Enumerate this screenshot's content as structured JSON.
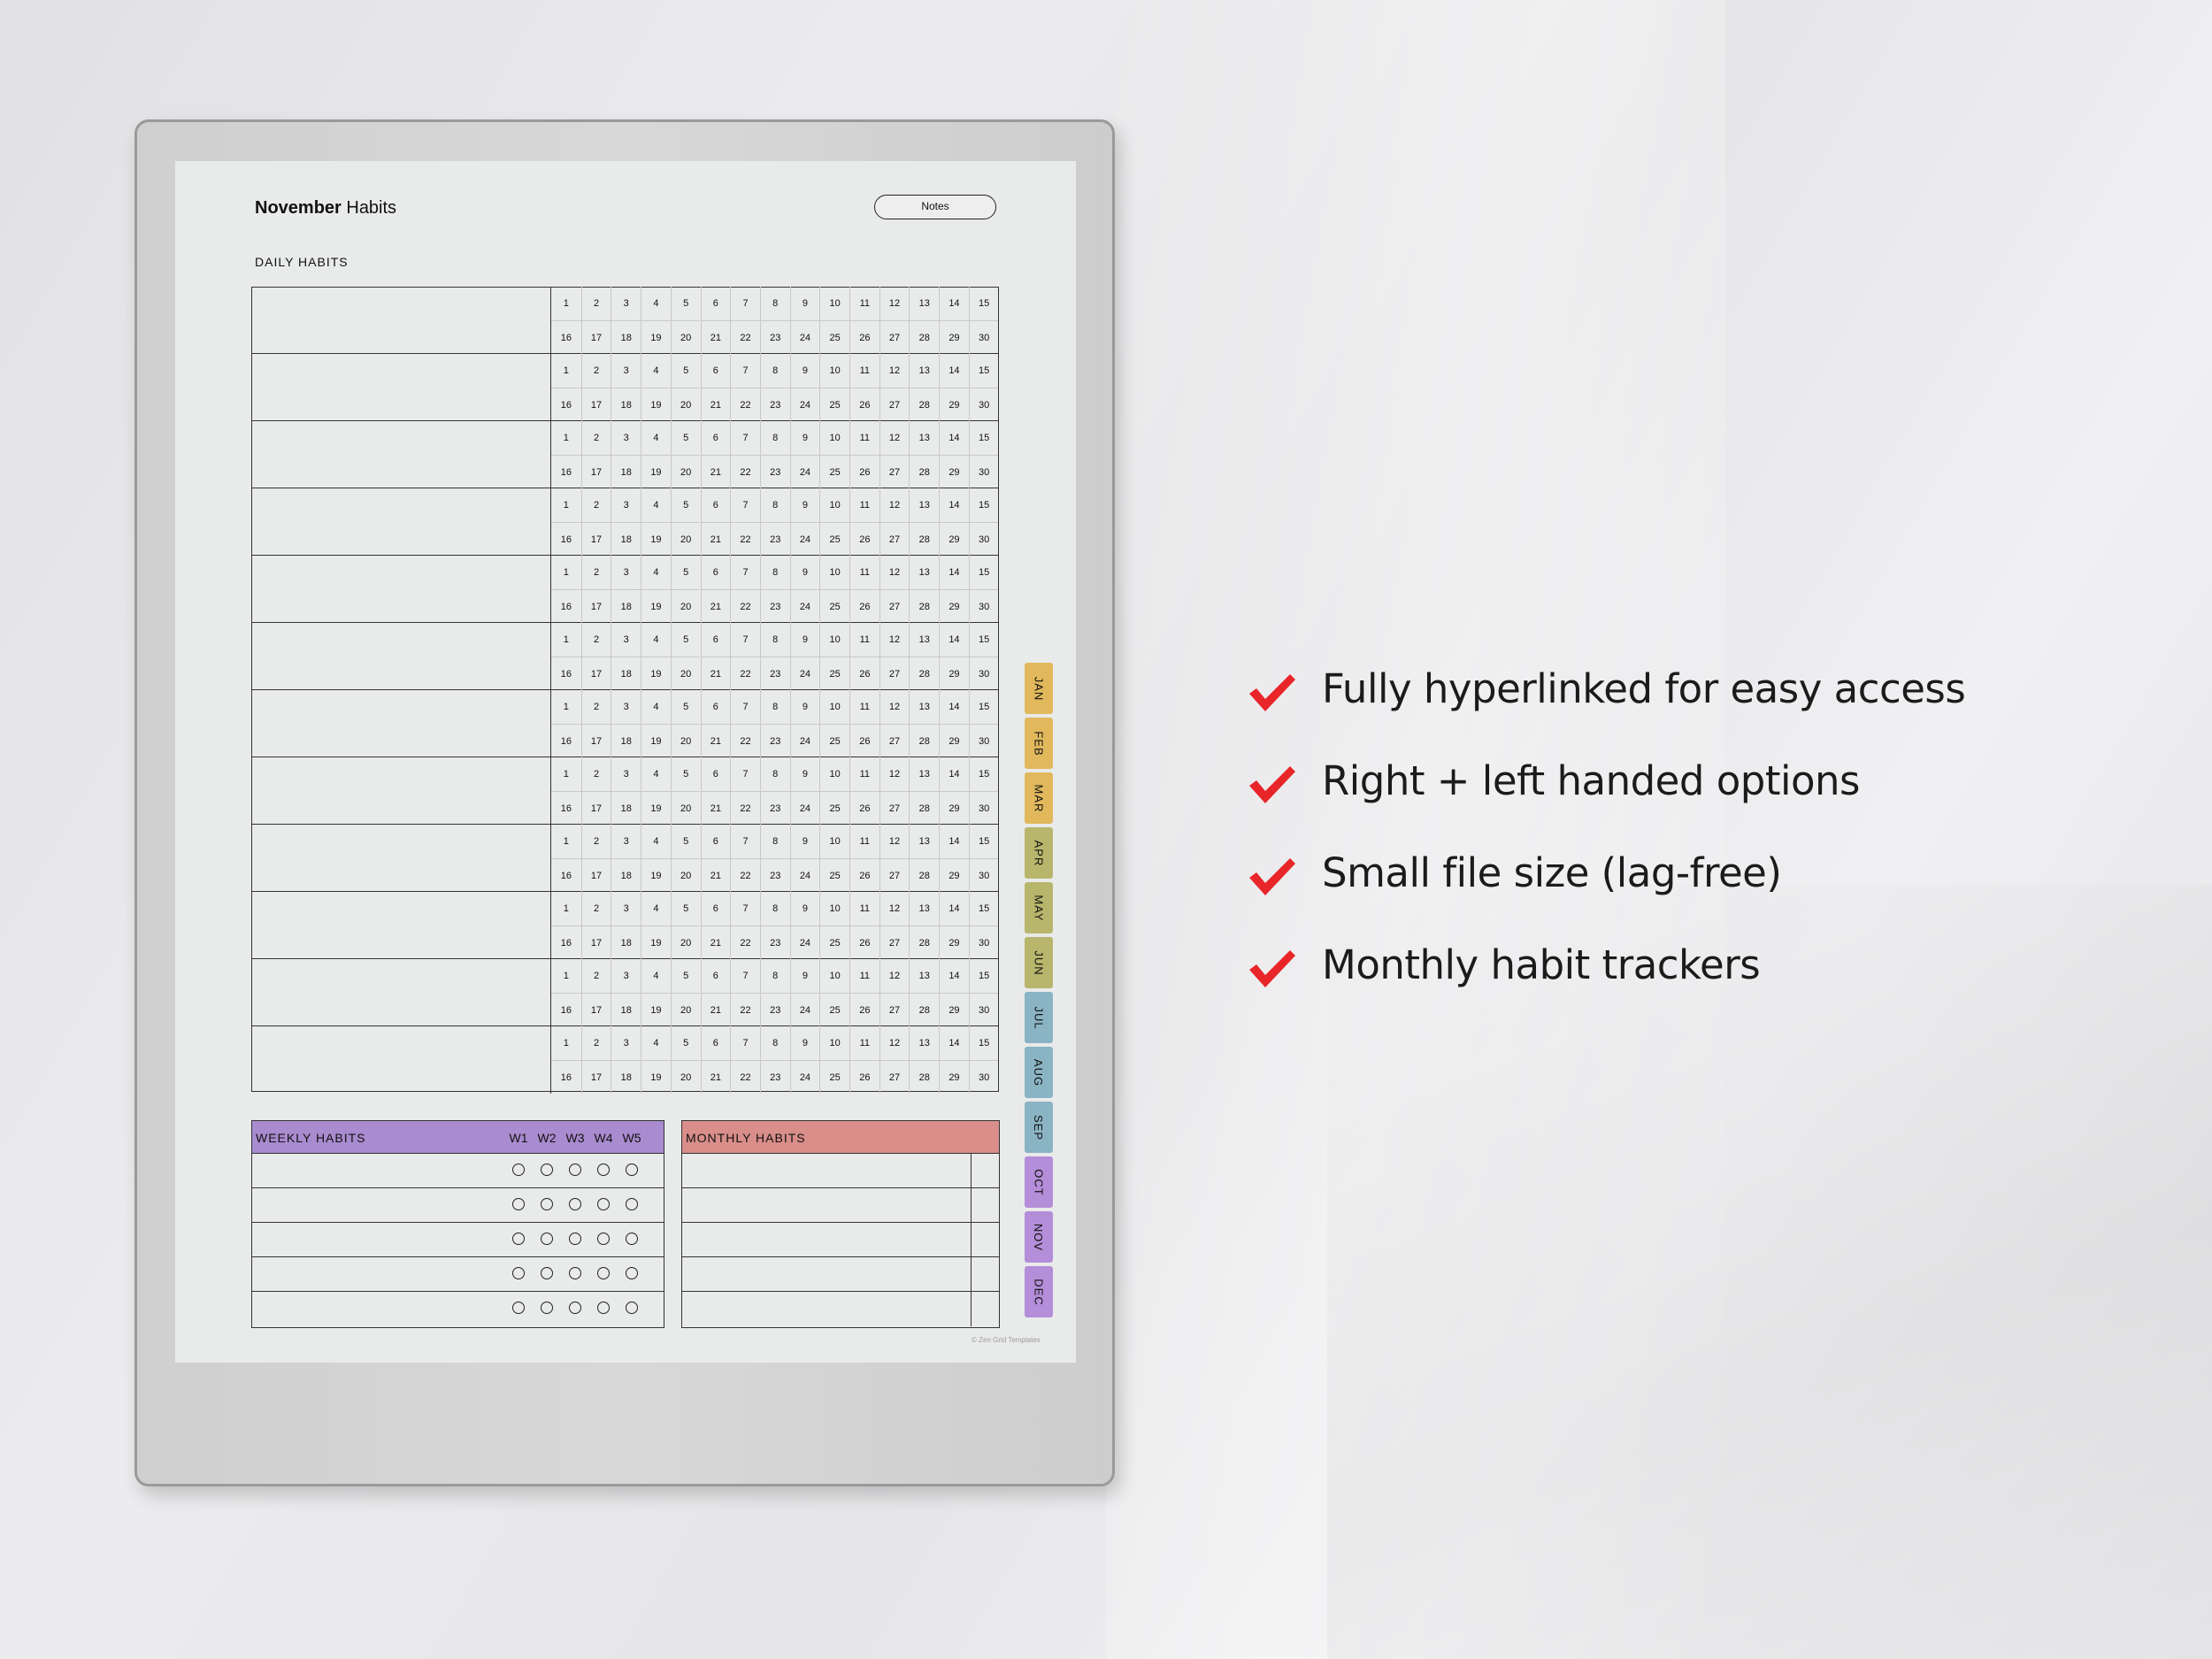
{
  "page": {
    "title_bold": "November",
    "title_rest": " Habits",
    "notes_label": "Notes",
    "daily_label": "DAILY HABITS",
    "copyright": "© Zen Grid Templates"
  },
  "daily": {
    "row_count": 12,
    "days_top": [
      "1",
      "2",
      "3",
      "4",
      "5",
      "6",
      "7",
      "8",
      "9",
      "10",
      "11",
      "12",
      "13",
      "14",
      "15"
    ],
    "days_bottom": [
      "16",
      "17",
      "18",
      "19",
      "20",
      "21",
      "22",
      "23",
      "24",
      "25",
      "26",
      "27",
      "28",
      "29",
      "30"
    ]
  },
  "weekly": {
    "title": "WEEKLY HABITS",
    "columns": [
      "W1",
      "W2",
      "W3",
      "W4",
      "W5"
    ],
    "row_count": 5,
    "color": "#a98bcf"
  },
  "monthly": {
    "title": "MONTHLY HABITS",
    "row_count": 5,
    "color": "#d98e8a"
  },
  "tabs": [
    {
      "label": "JAN",
      "color": "#e1b95c"
    },
    {
      "label": "FEB",
      "color": "#e1b95c"
    },
    {
      "label": "MAR",
      "color": "#e1b95c"
    },
    {
      "label": "APR",
      "color": "#b8b66c"
    },
    {
      "label": "MAY",
      "color": "#b8b66c"
    },
    {
      "label": "JUN",
      "color": "#b8b66c"
    },
    {
      "label": "JUL",
      "color": "#8ab4c4"
    },
    {
      "label": "AUG",
      "color": "#8ab4c4"
    },
    {
      "label": "SEP",
      "color": "#8ab4c4"
    },
    {
      "label": "OCT",
      "color": "#b48ed8"
    },
    {
      "label": "NOV",
      "color": "#b48ed8"
    },
    {
      "label": "DEC",
      "color": "#b48ed8"
    }
  ],
  "features": [
    {
      "text": "Fully hyperlinked for easy access",
      "icon": "checkmark-icon"
    },
    {
      "text": "Right + left handed options",
      "icon": "checkmark-icon"
    },
    {
      "text": "Small file size (lag-free)",
      "icon": "checkmark-icon"
    },
    {
      "text": "Monthly habit trackers",
      "icon": "checkmark-icon"
    }
  ],
  "accent": "#e8262a"
}
